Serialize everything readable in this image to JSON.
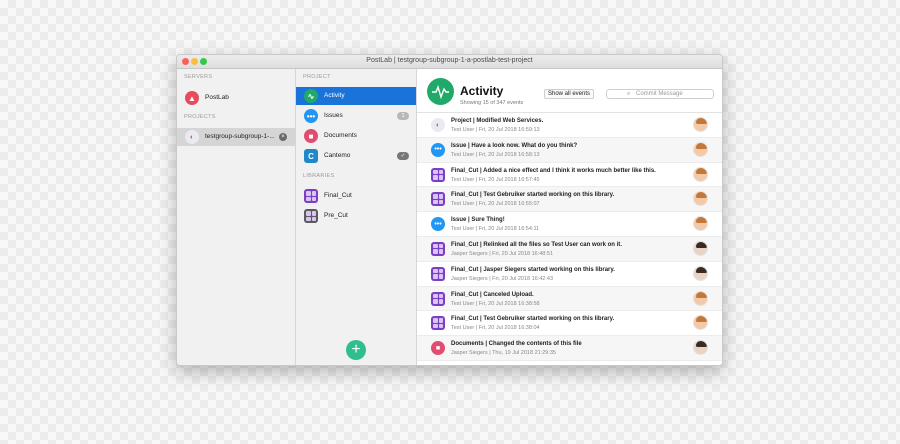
{
  "window": {
    "title": "PostLab | testgroup-subgroup-1-a-postlab-test-project"
  },
  "servers": {
    "section_label": "SERVERS",
    "items": [
      {
        "label": "PostLab",
        "icon": "postlab-triangle-icon",
        "color": "#e64c5c"
      }
    ]
  },
  "projects": {
    "section_label": "PROJECTS",
    "items": [
      {
        "label": "testgroup-subgroup-1-...",
        "icon": "project-icon"
      }
    ]
  },
  "project_nav": {
    "section_label": "PROJECT",
    "items": [
      {
        "label": "Activity",
        "icon": "activity-icon",
        "color": "#1faa6a",
        "selected": true
      },
      {
        "label": "Issues",
        "icon": "issues-icon",
        "color": "#2196f3",
        "badge": "1"
      },
      {
        "label": "Documents",
        "icon": "documents-icon",
        "color": "#e14d6e"
      },
      {
        "label": "Cantemo",
        "icon": "cantemo-icon",
        "color": "#1e88c9",
        "badge": "✓"
      }
    ]
  },
  "libraries": {
    "section_label": "LIBRARIES",
    "items": [
      {
        "label": "Final_Cut",
        "icon": "final-cut-library-icon",
        "color": "#7a3fc4"
      },
      {
        "label": "Pre_Cut",
        "icon": "pre-cut-library-icon",
        "color": "#5a5a5a"
      }
    ]
  },
  "add_button": {
    "label": "+"
  },
  "activity": {
    "title": "Activity",
    "subtitle": "Showing 15 of 347 events",
    "show_all_label": "Show all events",
    "search_placeholder": "Commit Message",
    "events": [
      {
        "title": "Project | Modified Web Services.",
        "meta": "Test User | Fri, 20 Jul 2018 16:59:13",
        "icon": "project",
        "avatar": "test-user"
      },
      {
        "title": "Issue | Have a look now. What do you think?",
        "meta": "Test User | Fri, 20 Jul 2018 16:58:13",
        "icon": "issue",
        "avatar": "test-user"
      },
      {
        "title": "Final_Cut | Added a nice effect and I think it works much better like this.",
        "meta": "Test User | Fri, 20 Jul 2018 16:57:45",
        "icon": "library",
        "avatar": "test-user"
      },
      {
        "title": "Final_Cut | Test Gebruiker started working on this library.",
        "meta": "Test User | Fri, 20 Jul 2018 16:55:07",
        "icon": "library",
        "avatar": "test-user"
      },
      {
        "title": "Issue | Sure Thing!",
        "meta": "Test User | Fri, 20 Jul 2018 16:54:11",
        "icon": "issue",
        "avatar": "test-user"
      },
      {
        "title": "Final_Cut | Relinked all the files so Test User can work on it.",
        "meta": "Jasper Siegers | Fri, 20 Jul 2018 16:48:51",
        "icon": "library",
        "avatar": "jasper"
      },
      {
        "title": "Final_Cut | Jasper Siegers started working on this library.",
        "meta": "Jasper Siegers | Fri, 20 Jul 2018 16:42:43",
        "icon": "library",
        "avatar": "jasper"
      },
      {
        "title": "Final_Cut | Canceled Upload.",
        "meta": "Test User | Fri, 20 Jul 2018 16:38:58",
        "icon": "library",
        "avatar": "test-user"
      },
      {
        "title": "Final_Cut | Test Gebruiker started working on this library.",
        "meta": "Test User | Fri, 20 Jul 2018 16:38:04",
        "icon": "library",
        "avatar": "test-user"
      },
      {
        "title": "Documents | Changed the contents of this file",
        "meta": "Jasper Siegers | Thu, 19 Jul 2018 21:29:35",
        "icon": "documents",
        "avatar": "jasper"
      }
    ]
  }
}
